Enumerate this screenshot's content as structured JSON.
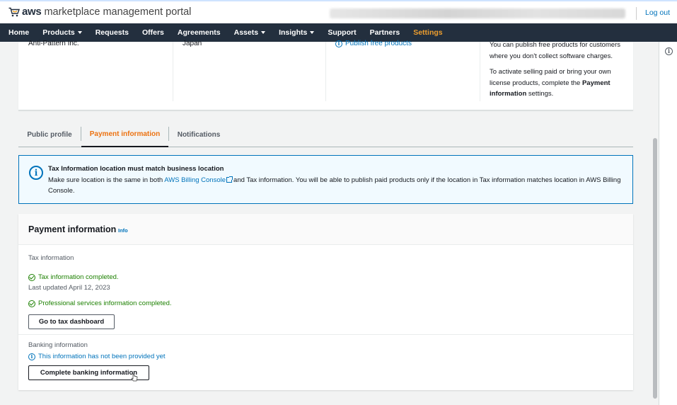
{
  "header": {
    "brand_aws": "aws",
    "brand_rest": "marketplace management portal",
    "logout": "Log out"
  },
  "nav": {
    "items": [
      {
        "label": "Home",
        "dropdown": false
      },
      {
        "label": "Products",
        "dropdown": true
      },
      {
        "label": "Requests",
        "dropdown": false
      },
      {
        "label": "Offers",
        "dropdown": false
      },
      {
        "label": "Agreements",
        "dropdown": false
      },
      {
        "label": "Assets",
        "dropdown": true
      },
      {
        "label": "Insights",
        "dropdown": true
      },
      {
        "label": "Support",
        "dropdown": false
      },
      {
        "label": "Partners",
        "dropdown": false
      },
      {
        "label": "Settings",
        "dropdown": false,
        "active": true
      }
    ]
  },
  "top_card": {
    "company_name": "Anti-Pattern Inc.",
    "country": "Japan",
    "publish_free_link": "Publish free products",
    "note_1": "You can publish free products for customers where you don't collect software charges.",
    "note_2_prefix": "To activate selling paid or bring your own license products, complete the",
    "note_2_bold": "Payment information",
    "note_2_suffix": "settings."
  },
  "tabs": [
    {
      "label": "Public profile",
      "active": false
    },
    {
      "label": "Payment information",
      "active": true
    },
    {
      "label": "Notifications",
      "active": false
    }
  ],
  "alert": {
    "title": "Tax Information location must match business location",
    "body_prefix": "Make sure location is the same in both",
    "link": "AWS Billing Console",
    "body_suffix": "and Tax information. You will be able to publish paid products only if the location in Tax information matches location in AWS Billing Console."
  },
  "payment": {
    "title": "Payment information",
    "info_link": "Info",
    "tax_label": "Tax information",
    "tax_status": "Tax information completed.",
    "last_updated": "Last updated April 12, 2023",
    "ps_status": "Professional services information completed.",
    "tax_button": "Go to tax dashboard",
    "banking_label": "Banking information",
    "banking_status": "This information has not been provided yet",
    "banking_button": "Complete banking information"
  },
  "colors": {
    "nav_bg": "#232f3e",
    "accent_orange": "#ec7211",
    "link_blue": "#0073bb",
    "success_green": "#1d8102"
  },
  "icons": {
    "brand": "cart-icon",
    "rail": "info-icon",
    "status_ok": "check-circle-icon",
    "status_info": "info-circle-icon",
    "external": "external-link-icon"
  }
}
